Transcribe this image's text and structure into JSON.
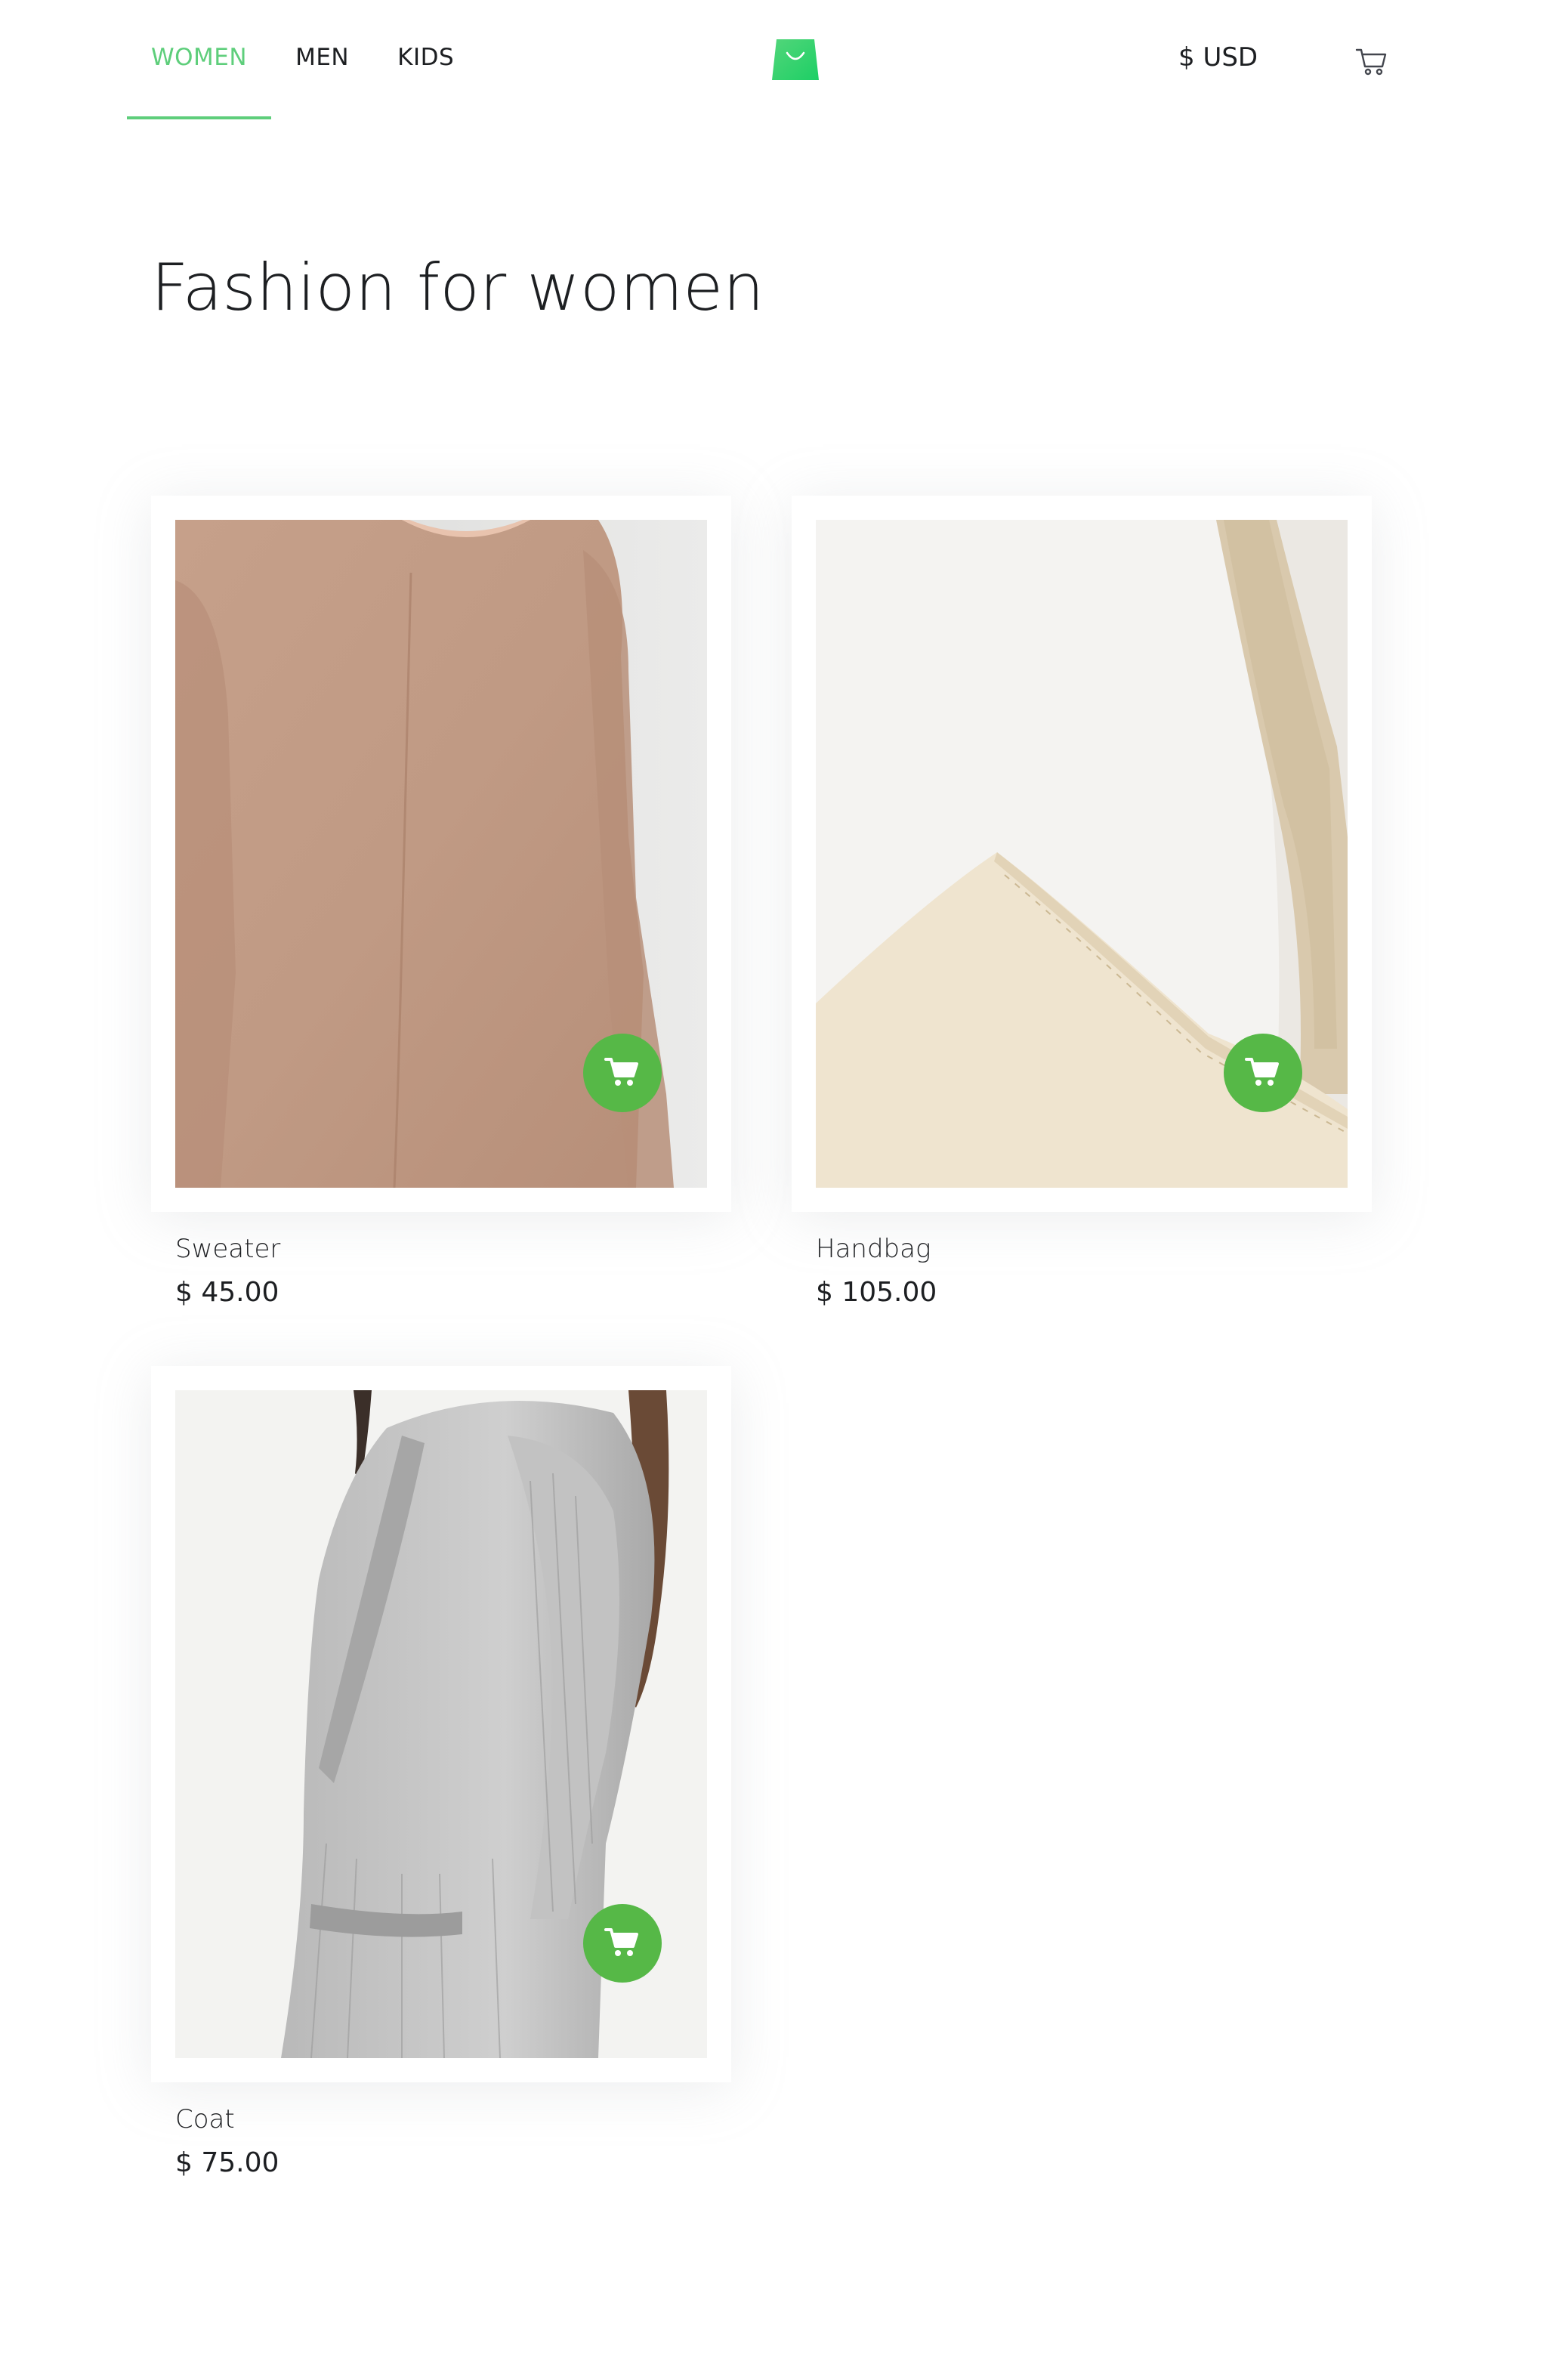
{
  "header": {
    "nav": [
      {
        "label": "WOMEN",
        "active": true
      },
      {
        "label": "MEN",
        "active": false
      },
      {
        "label": "KIDS",
        "active": false
      }
    ],
    "logo_icon": "shopping-bag-icon",
    "currency_label": "$ USD",
    "cart_icon": "cart-icon"
  },
  "page": {
    "title": "Fashion for women"
  },
  "products": [
    {
      "name": "Sweater",
      "price": "$ 45.00",
      "action_icon": "add-to-cart-icon"
    },
    {
      "name": "Handbag",
      "price": "$ 105.00",
      "action_icon": "add-to-cart-icon"
    },
    {
      "name": "Coat",
      "price": "$ 75.00",
      "action_icon": "add-to-cart-icon"
    }
  ],
  "colors": {
    "accent": "#5ece7b",
    "cart_button": "#56b847",
    "text": "#1d1f22"
  }
}
